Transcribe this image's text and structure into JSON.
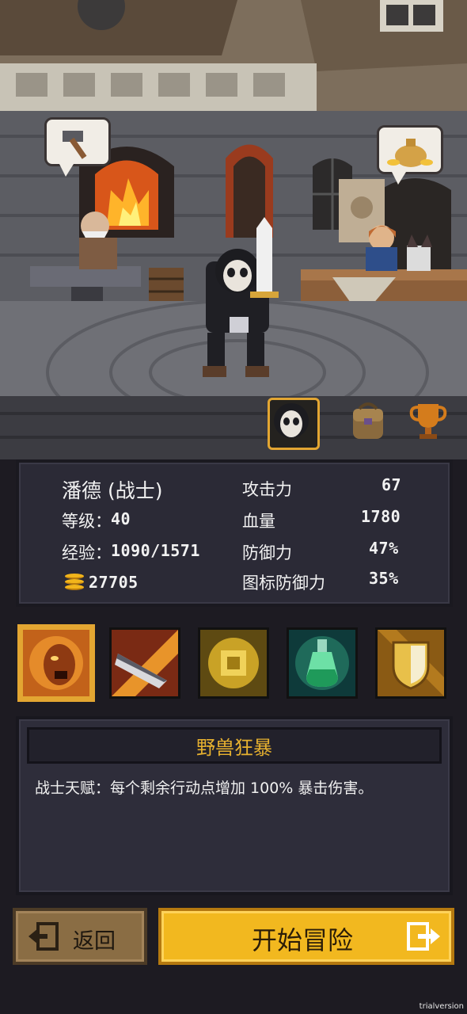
{
  "hero": {
    "name": "潘德 (战士)",
    "level_label": "等级：",
    "level_value": "40",
    "exp_label": "经验：",
    "exp_value": "1090/1571",
    "gold": "27705"
  },
  "stats": [
    {
      "label": "攻击力",
      "value": "67"
    },
    {
      "label": "血量",
      "value": "1780"
    },
    {
      "label": "防御力",
      "value": "47%"
    },
    {
      "label": "图标防御力",
      "value": "35%"
    }
  ],
  "tabs": [
    {
      "icon": "hero-portrait-icon",
      "active": true
    },
    {
      "icon": "backpack-icon",
      "active": false
    },
    {
      "icon": "trophy-icon",
      "active": false
    }
  ],
  "bubbles": [
    {
      "icon": "hammer-icon"
    },
    {
      "icon": "money-bag-icon"
    }
  ],
  "skills": [
    {
      "icon": "beast-rage-icon",
      "selected": true
    },
    {
      "icon": "blade-strike-icon",
      "selected": false
    },
    {
      "icon": "golden-idol-icon",
      "selected": false
    },
    {
      "icon": "potion-icon",
      "selected": false
    },
    {
      "icon": "shield-icon",
      "selected": false
    }
  ],
  "skill_detail": {
    "title": "野兽狂暴",
    "description": "战士天赋：每个剩余行动点增加 100% 暴击伤害。"
  },
  "buttons": {
    "back": "返回",
    "start": "开始冒险"
  },
  "watermark": "trialversion",
  "colors": {
    "accent": "#f2b81f",
    "title_gold": "#e7b12f",
    "panel": "#2b2a36"
  }
}
